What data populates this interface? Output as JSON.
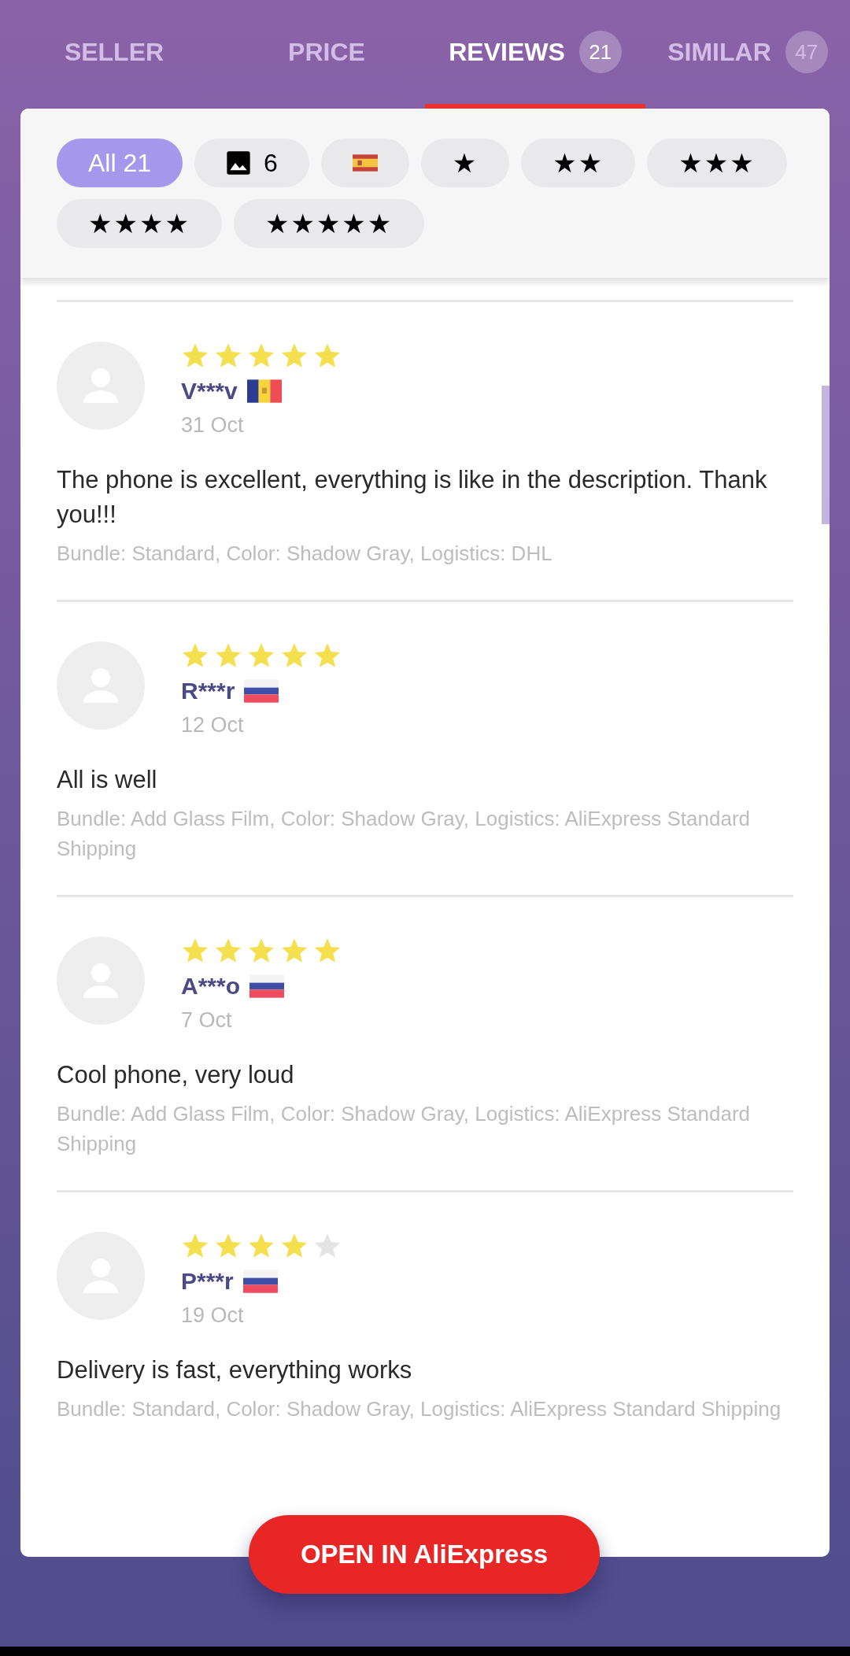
{
  "tabs": [
    {
      "label": "SELLER",
      "selected": false
    },
    {
      "label": "PRICE",
      "selected": false
    },
    {
      "label": "REVIEWS",
      "count": "21",
      "selected": true
    },
    {
      "label": "SIMILAR",
      "count": "47",
      "selected": false
    }
  ],
  "filters": [
    {
      "kind": "text",
      "label": "All 21",
      "selected": true
    },
    {
      "kind": "photo",
      "label": "6",
      "selected": false
    },
    {
      "kind": "flag",
      "flag": {
        "kind": "spain"
      },
      "selected": false
    },
    {
      "kind": "stars",
      "label": "★",
      "selected": false
    },
    {
      "kind": "stars",
      "label": "★★",
      "selected": false
    },
    {
      "kind": "stars",
      "label": "★★★",
      "selected": false
    },
    {
      "kind": "stars",
      "label": "★★★★",
      "selected": false
    },
    {
      "kind": "stars",
      "label": "★★★★★",
      "selected": false
    }
  ],
  "reviews": [
    {
      "stars": 5,
      "name": "V***v",
      "flag": {
        "kind": "andorra"
      },
      "date": "31 Oct",
      "text": "The phone is excellent, everything is like in the description. Thank you!!!",
      "details": "Bundle: Standard, Color: Shadow Gray, Logistics: DHL"
    },
    {
      "stars": 5,
      "name": "R***r",
      "flag": {
        "kind": "russia"
      },
      "date": "12 Oct",
      "text": "All is well",
      "details": "Bundle: Add Glass Film, Color: Shadow Gray, Logistics: AliExpress Standard Shipping"
    },
    {
      "stars": 5,
      "name": "A***o",
      "flag": {
        "kind": "russia"
      },
      "date": "7 Oct",
      "text": "Cool phone, very loud",
      "details": "Bundle: Add Glass Film, Color: Shadow Gray, Logistics: AliExpress Standard Shipping"
    },
    {
      "stars": 4,
      "name": "P***r",
      "flag": {
        "kind": "russia"
      },
      "date": "19 Oct",
      "text": "Delivery is fast, everything works",
      "details": "Bundle: Standard, Color: Shadow Gray, Logistics: AliExpress Standard Shipping"
    }
  ],
  "open_button": "OPEN IN AliExpress"
}
